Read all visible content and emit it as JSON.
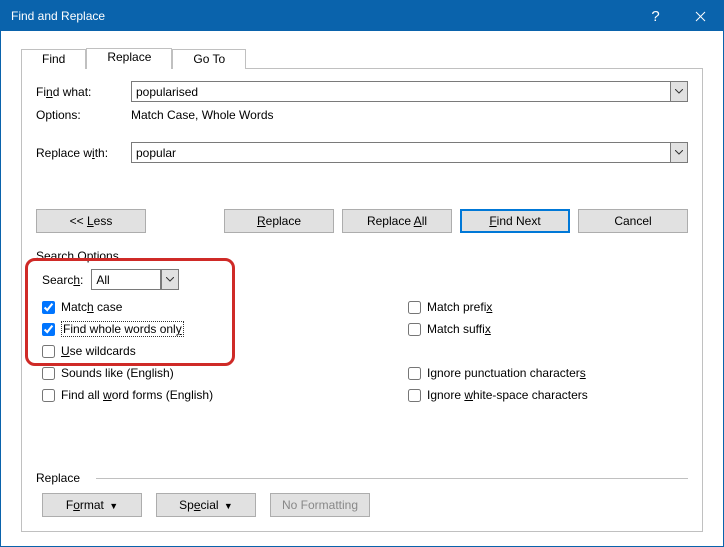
{
  "title": "Find and Replace",
  "tabs": {
    "find": "Find",
    "replace": "Replace",
    "goto": "Go To"
  },
  "labels": {
    "findwhat": "Find what:",
    "options": "Options:",
    "optionsval": "Match Case, Whole Words",
    "replacewith": "Replace with:",
    "search": "Search:",
    "searchoptions": "Search Options",
    "replace_section": "Replace"
  },
  "fields": {
    "findwhat": "popularised",
    "replacewith": "popular",
    "search_scope": "All"
  },
  "buttons": {
    "less": "<< Less",
    "replace": "Replace",
    "replaceall": "Replace All",
    "findnext": "Find Next",
    "cancel": "Cancel",
    "format": "Format",
    "special": "Special",
    "noformatting": "No Formatting"
  },
  "checks": {
    "matchcase": "Match case",
    "wholewords": "Find whole words only",
    "wildcards": "Use wildcards",
    "soundslike": "Sounds like (English)",
    "wordforms": "Find all word forms (English)",
    "matchprefix": "Match prefix",
    "matchsuffix": "Match suffix",
    "ignorepunct": "Ignore punctuation characters",
    "ignorews": "Ignore white-space characters"
  },
  "checked": {
    "matchcase": true,
    "wholewords": true,
    "wildcards": false,
    "soundslike": false,
    "wordforms": false,
    "matchprefix": false,
    "matchsuffix": false,
    "ignorepunct": false,
    "ignorews": false
  }
}
